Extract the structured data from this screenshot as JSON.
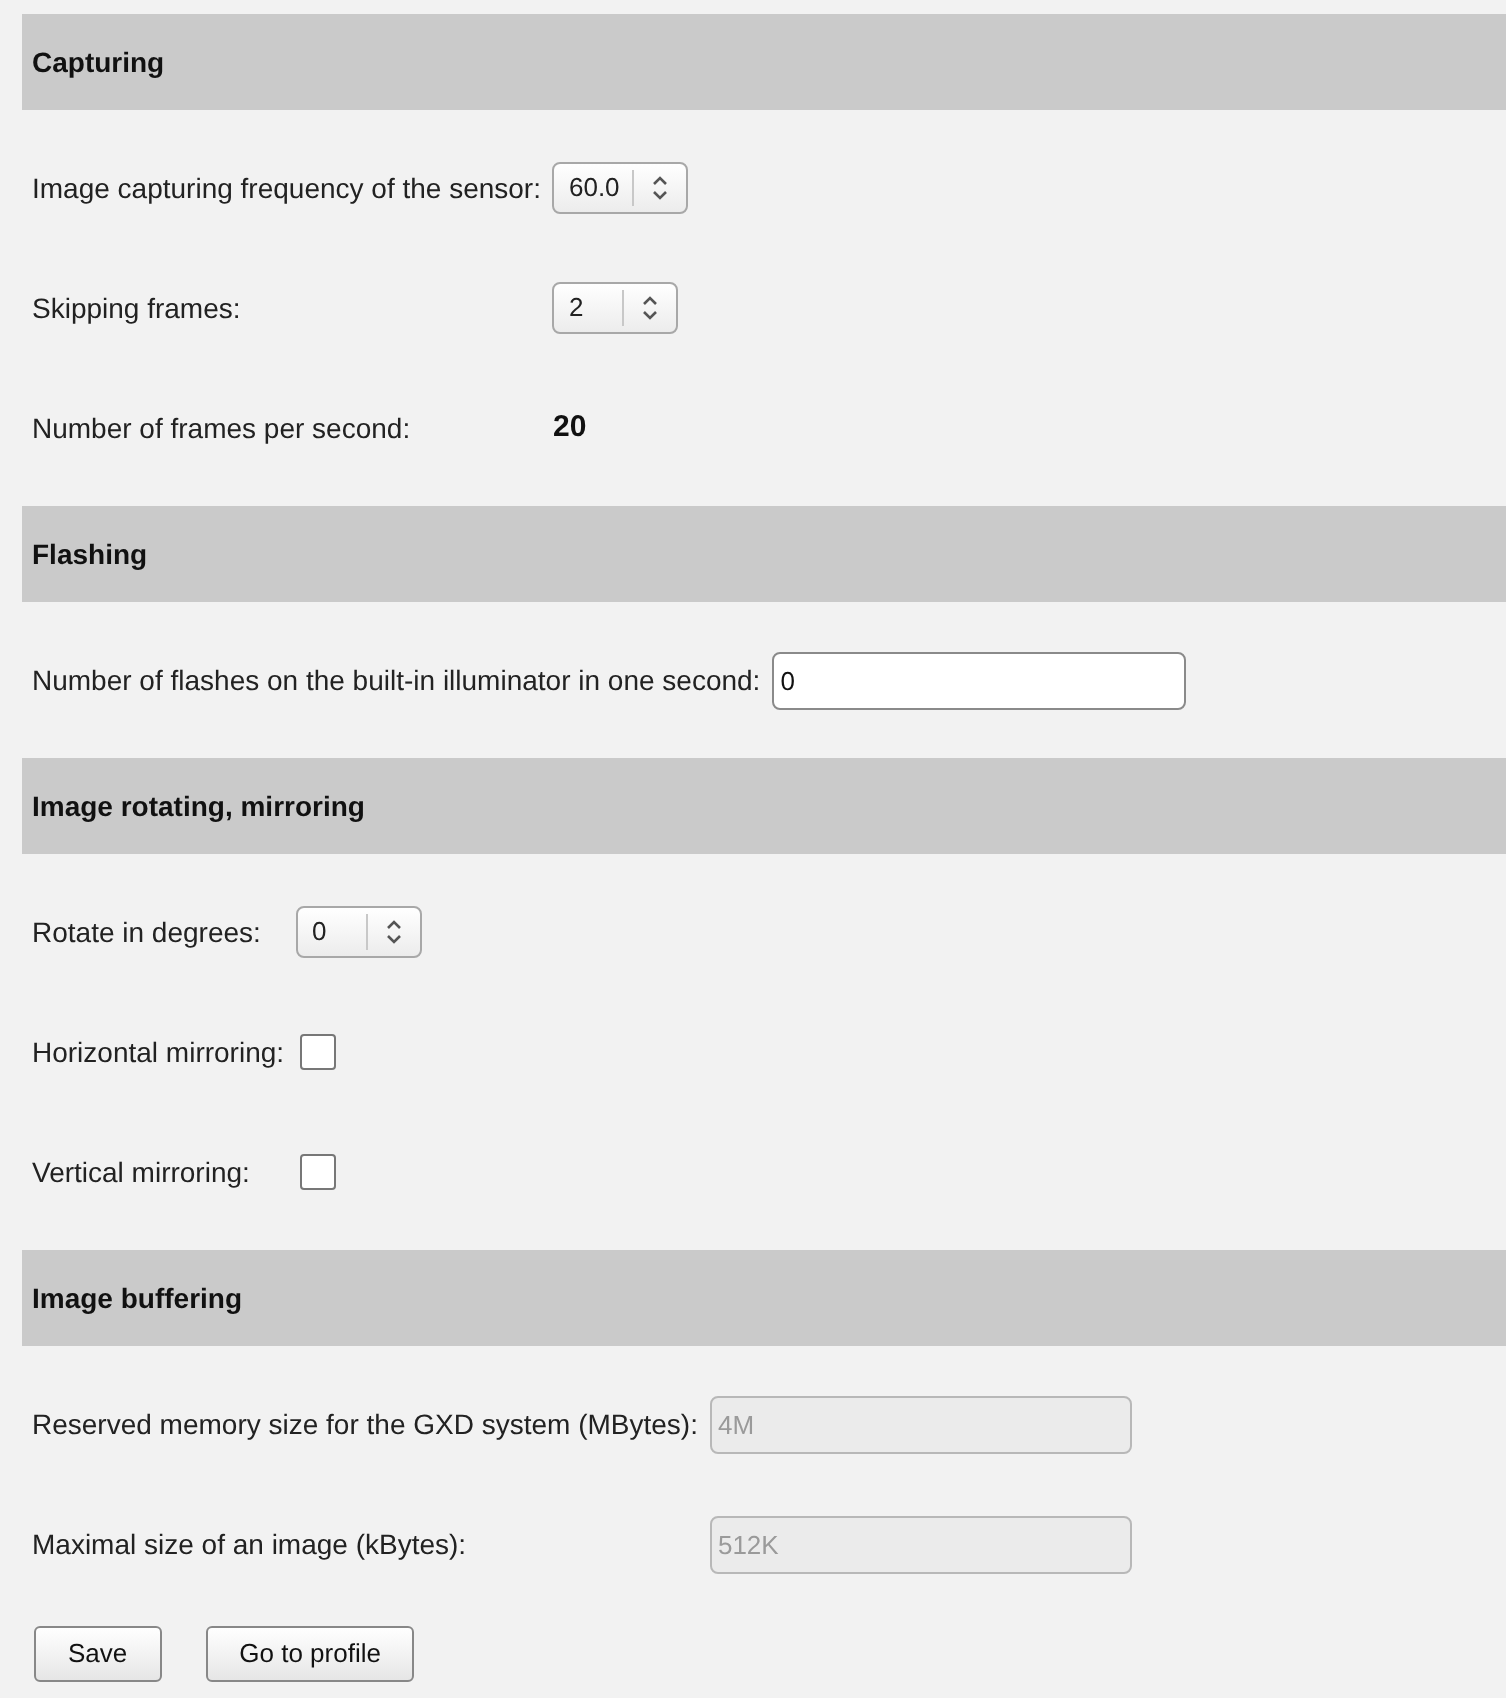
{
  "sections": [
    {
      "title": "Capturing",
      "rows": [
        {
          "kind": "spinner",
          "label": "Image capturing frequency of the sensor:",
          "value": "60.0"
        },
        {
          "kind": "spinner",
          "label": "Skipping frames:",
          "value": "2"
        },
        {
          "kind": "readout",
          "label": "Number of frames per second:",
          "value": "20"
        }
      ]
    },
    {
      "title": "Flashing",
      "rows": [
        {
          "kind": "text",
          "label": "Number of flashes on the built-in illuminator in one second:",
          "value": "0",
          "disabled": false
        }
      ]
    },
    {
      "title": "Image rotating, mirroring",
      "rows": [
        {
          "kind": "spinner",
          "label": "Rotate in degrees:",
          "value": "0"
        },
        {
          "kind": "checkbox",
          "label": "Horizontal mirroring:",
          "checked": false
        },
        {
          "kind": "checkbox",
          "label": "Vertical mirroring:",
          "checked": false
        }
      ]
    },
    {
      "title": "Image buffering",
      "rows": [
        {
          "kind": "text",
          "label": "Reserved memory size for the GXD system (MBytes):",
          "value": "4M",
          "disabled": true
        },
        {
          "kind": "text",
          "label": "Maximal size of an image (kBytes):",
          "value": "512K",
          "disabled": true
        }
      ]
    }
  ],
  "buttons": [
    "Save",
    "Go to profile"
  ]
}
